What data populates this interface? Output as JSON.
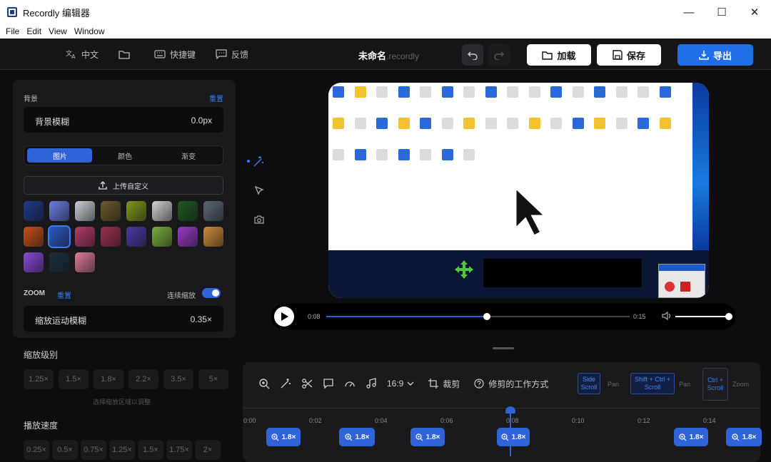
{
  "window": {
    "title": "Recordly 编辑器",
    "minimize": "—",
    "maximize": "☐",
    "close": "✕"
  },
  "menu": [
    "File",
    "Edit",
    "View",
    "Window"
  ],
  "toolbar": {
    "language": "中文",
    "shortcuts": "快捷键",
    "feedback": "反馈",
    "doc_name": "未命名",
    "doc_ext": ".recordly",
    "load": "加载",
    "save": "保存",
    "export": "导出"
  },
  "background": {
    "label": "背景",
    "reset": "重置",
    "blur_label": "背景模糊",
    "blur_value": "0.0px",
    "tabs": [
      "图片",
      "颜色",
      "渐变"
    ],
    "upload": "上传自定义"
  },
  "wallpapers": [
    "#1d3a8a",
    "#6a7ee8",
    "#c9cfd6",
    "#6b5a2a",
    "#7a9a1a",
    "#d0d0d0",
    "#1f5a24",
    "#5a6a7a",
    "#c4521a",
    "#2a5ac8",
    "#b73a6a",
    "#a03050",
    "#4a3aa8",
    "#78b03a",
    "#9a3ac8",
    "#d08a3a",
    "#8a4ad8",
    "#1a3040",
    "#e07a9a"
  ],
  "zoom": {
    "label": "ZOOM",
    "reset": "重置",
    "continuous": "连续缩放",
    "motion_blur_label": "缩放运动模糊",
    "motion_blur_value": "0.35×",
    "level_label": "缩放级别",
    "levels": [
      "1.25×",
      "1.5×",
      "1.8×",
      "2.2×",
      "3.5×",
      "5×"
    ],
    "level_note": "选择缩放区域以调整"
  },
  "speed": {
    "label": "播放速度",
    "values": [
      "0.25×",
      "0.5×",
      "0.75×",
      "1.25×",
      "1.5×",
      "1.75×",
      "2×"
    ]
  },
  "player": {
    "current": "0:08",
    "duration": "0:15",
    "progress": 0.53,
    "volume": 1.0
  },
  "timeline": {
    "aspect": "16:9",
    "crop": "裁剪",
    "howto": "修剪的工作方式",
    "hints": [
      {
        "key": "Side Scroll",
        "action": "Pan"
      },
      {
        "key": "Shift + Ctrl + Scroll",
        "action": "Pan"
      },
      {
        "key": "Ctrl + Scroll",
        "action": "Zoom"
      }
    ],
    "ticks": [
      "0:00",
      "0:02",
      "0:04",
      "0:06",
      "0:08",
      "0:10",
      "0:12",
      "0:14"
    ],
    "clips": [
      "1.8×",
      "1.8×",
      "1.8×",
      "1.8×",
      "1.8×",
      "1.8×"
    ]
  }
}
